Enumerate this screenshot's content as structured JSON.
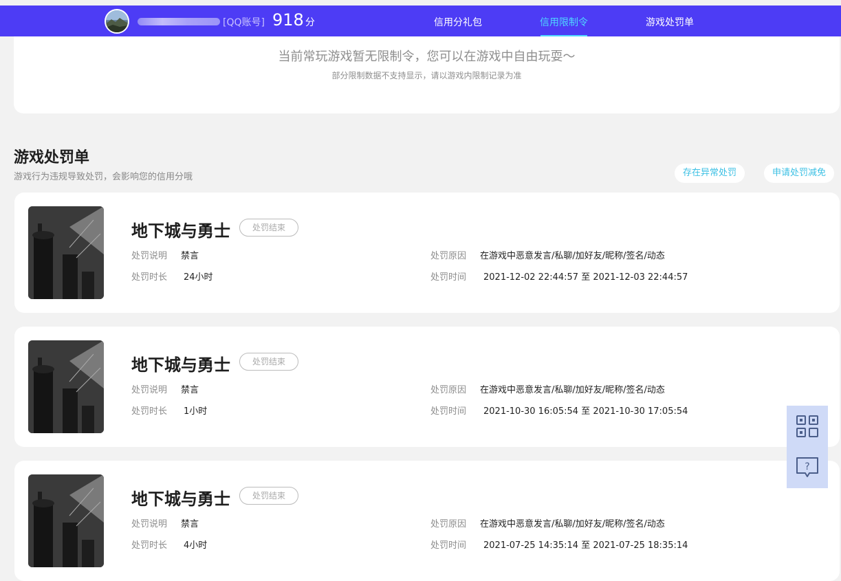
{
  "header": {
    "account_label": "[QQ账号]",
    "score": "918",
    "score_unit": "分",
    "nav": [
      {
        "label": "信用分礼包"
      },
      {
        "label": "信用限制令"
      },
      {
        "label": "游戏处罚单"
      }
    ],
    "active_nav": "信用限制令",
    "accent": "#4d3cf5",
    "active_color": "#4fd7ff"
  },
  "notice": {
    "main": "当前常玩游戏暂无限制令，您可以在游戏中自由玩耍～",
    "sub": "部分限制数据不支持显示，请以游戏内限制记录为准"
  },
  "section": {
    "title": "游戏处罚单",
    "subtitle": "游戏行为违规导致处罚，会影响您的信用分哦",
    "btn_abnormal": "存在异常处罚",
    "btn_appeal": "申请处罚减免"
  },
  "labels": {
    "desc": "处罚说明",
    "duration": "处罚时长",
    "reason": "处罚原因",
    "time": "处罚时间"
  },
  "records": [
    {
      "game": "地下城与勇士",
      "status": "处罚结束",
      "desc": "禁言",
      "duration": "24小时",
      "reason": "在游戏中恶意发言/私聊/加好友/昵称/签名/动态",
      "time": "2021-12-02 22:44:57 至 2021-12-03 22:44:57"
    },
    {
      "game": "地下城与勇士",
      "status": "处罚结束",
      "desc": "禁言",
      "duration": "1小时",
      "reason": "在游戏中恶意发言/私聊/加好友/昵称/签名/动态",
      "time": "2021-10-30 16:05:54 至 2021-10-30 17:05:54"
    },
    {
      "game": "地下城与勇士",
      "status": "处罚结束",
      "desc": "禁言",
      "duration": "4小时",
      "reason": "在游戏中恶意发言/私聊/加好友/昵称/签名/动态",
      "time": "2021-07-25 14:35:14 至 2021-07-25 18:35:14"
    }
  ],
  "float_icons": [
    "qrcode-icon",
    "help-chat-icon"
  ]
}
